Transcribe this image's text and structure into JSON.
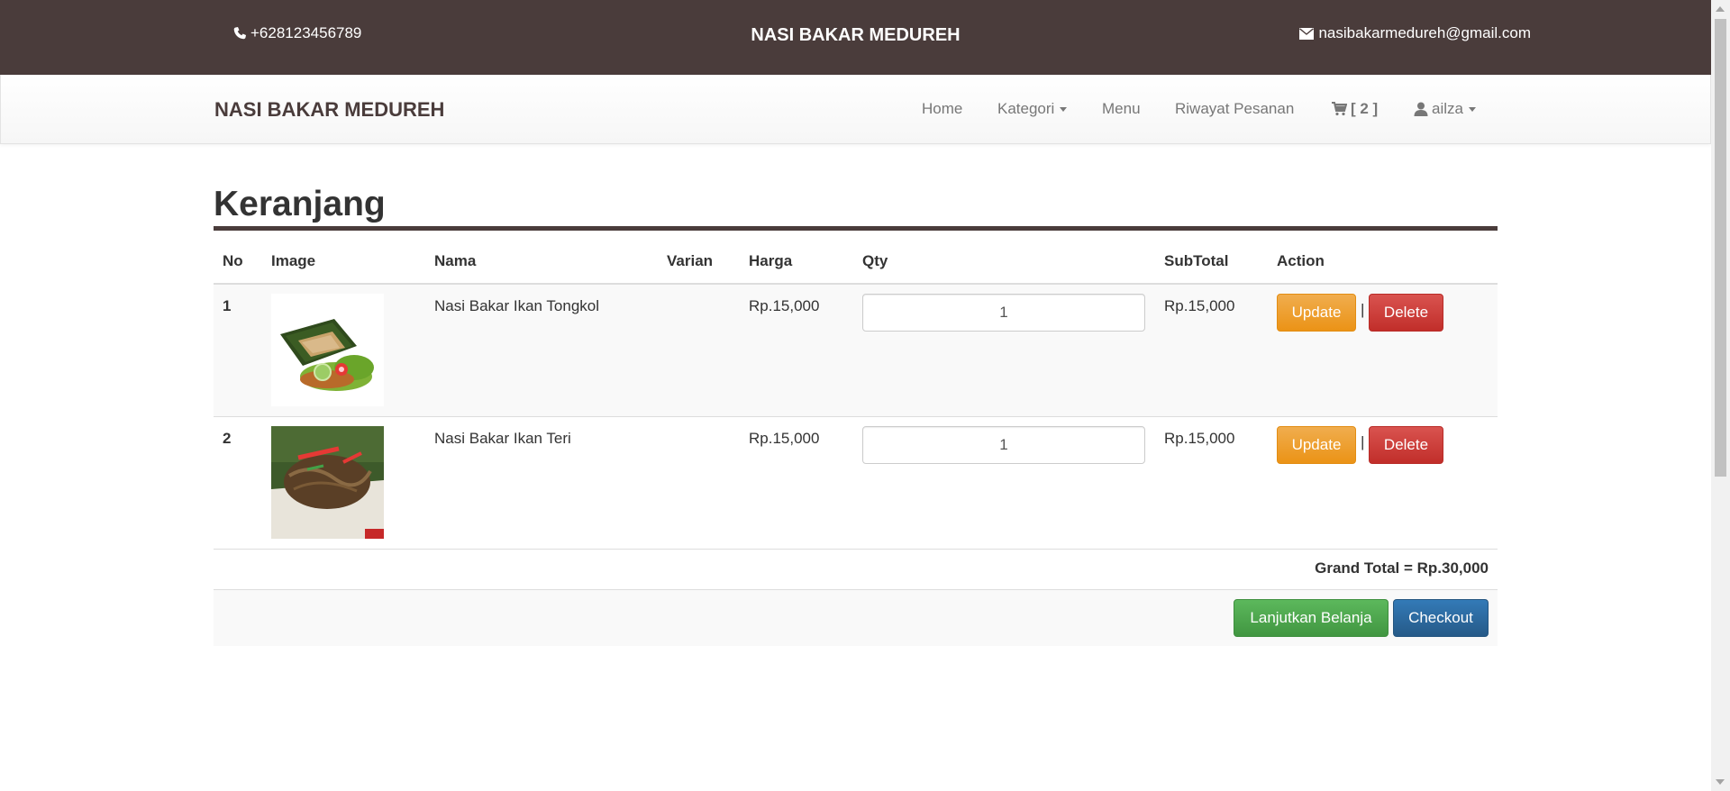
{
  "topbar": {
    "phone": "+628123456789",
    "brand": "NASI BAKAR MEDUREH",
    "email": "nasibakarmedureh@gmail.com",
    "phone_icon": "phone-icon",
    "email_icon": "envelope-icon",
    "background": "#4a3c3b"
  },
  "navbar": {
    "logo": "NASI BAKAR MEDUREH",
    "home": "Home",
    "kategori": "Kategori",
    "menu": "Menu",
    "riwayat": "Riwayat Pesanan",
    "cart_count": "[ 2 ]",
    "cart_icon": "shopping-cart-icon",
    "user": "ailza",
    "user_icon": "user-icon"
  },
  "page": {
    "title": "Keranjang"
  },
  "table": {
    "headers": {
      "no": "No",
      "image": "Image",
      "nama": "Nama",
      "varian": "Varian",
      "harga": "Harga",
      "qty": "Qty",
      "subtotal": "SubTotal",
      "action": "Action"
    },
    "rows": [
      {
        "no": "1",
        "image": "grilled-rice-tongkol",
        "nama": "Nasi Bakar Ikan Tongkol",
        "varian": "",
        "harga": "Rp.15,000",
        "qty": "1",
        "subtotal": "Rp.15,000"
      },
      {
        "no": "2",
        "image": "grilled-rice-teri",
        "nama": "Nasi Bakar Ikan Teri",
        "varian": "",
        "harga": "Rp.15,000",
        "qty": "1",
        "subtotal": "Rp.15,000"
      }
    ],
    "update_label": "Update",
    "delete_label": "Delete",
    "separator": "|",
    "grand_total": "Grand Total = Rp.30,000"
  },
  "actions": {
    "continue_label": "Lanjutkan Belanja",
    "checkout_label": "Checkout"
  },
  "colors": {
    "update": "#f0ad4e",
    "delete": "#d9534f",
    "continue": "#5cb85c",
    "checkout": "#337ab7"
  }
}
